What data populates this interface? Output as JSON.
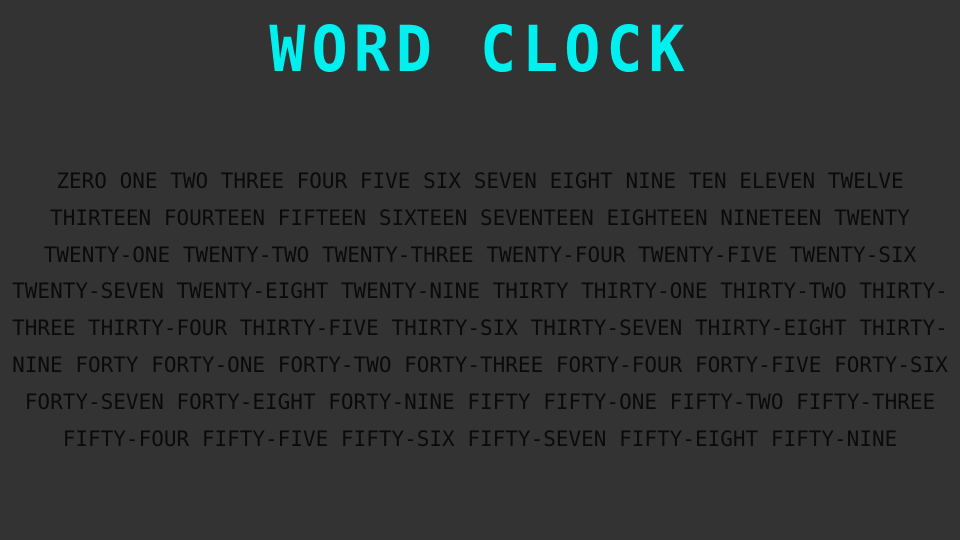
{
  "app": {
    "title": "WORD CLOCK"
  },
  "word_list": {
    "words": [
      "ZERO",
      "ONE",
      "TWO",
      "THREE",
      "FOUR",
      "FIVE",
      "SIX",
      "SEVEN",
      "EIGHT",
      "NINE",
      "TEN",
      "ELEVEN",
      "TWELVE",
      "THIRTEEN",
      "FOURTEEN",
      "FIFTEEN",
      "SIXTEEN",
      "SEVENTEEN",
      "EIGHTEEN",
      "NINETEEN",
      "TWENTY",
      "TWENTY-ONE",
      "TWENTY-TWO",
      "TWENTY-THREE",
      "TWENTY-FOUR",
      "TWENTY-FIVE",
      "TWENTY-SIX",
      "TWENTY-SEVEN",
      "TWENTY-EIGHT",
      "TWENTY-NINE",
      "THIRTY",
      "THIRTY-ONE",
      "THIRTY-TWO",
      "THIRTY-THREE",
      "THIRTY-FOUR",
      "THIRTY-FIVE",
      "THIRTY-SIX",
      "THIRTY-SEVEN",
      "THIRTY-EIGHT",
      "THIRTY-NINE",
      "FORTY",
      "FORTY-ONE",
      "FORTY-TWO",
      "FORTY-THREE",
      "FORTY-FOUR",
      "FORTY-FIVE",
      "FORTY-SIX",
      "FORTY-SEVEN",
      "FORTY-EIGHT",
      "FORTY-NINE",
      "FIFTY",
      "FIFTY-ONE",
      "FIFTY-TWO",
      "FIFTY-THREE",
      "FIFTY-FOUR",
      "FIFTY-FIVE",
      "FIFTY-SIX",
      "FIFTY-SEVEN",
      "FIFTY-EIGHT",
      "FIFTY-NINE"
    ]
  },
  "colors": {
    "background": "#333333",
    "title": "#00f0f0",
    "words": "#0a0a0a"
  }
}
